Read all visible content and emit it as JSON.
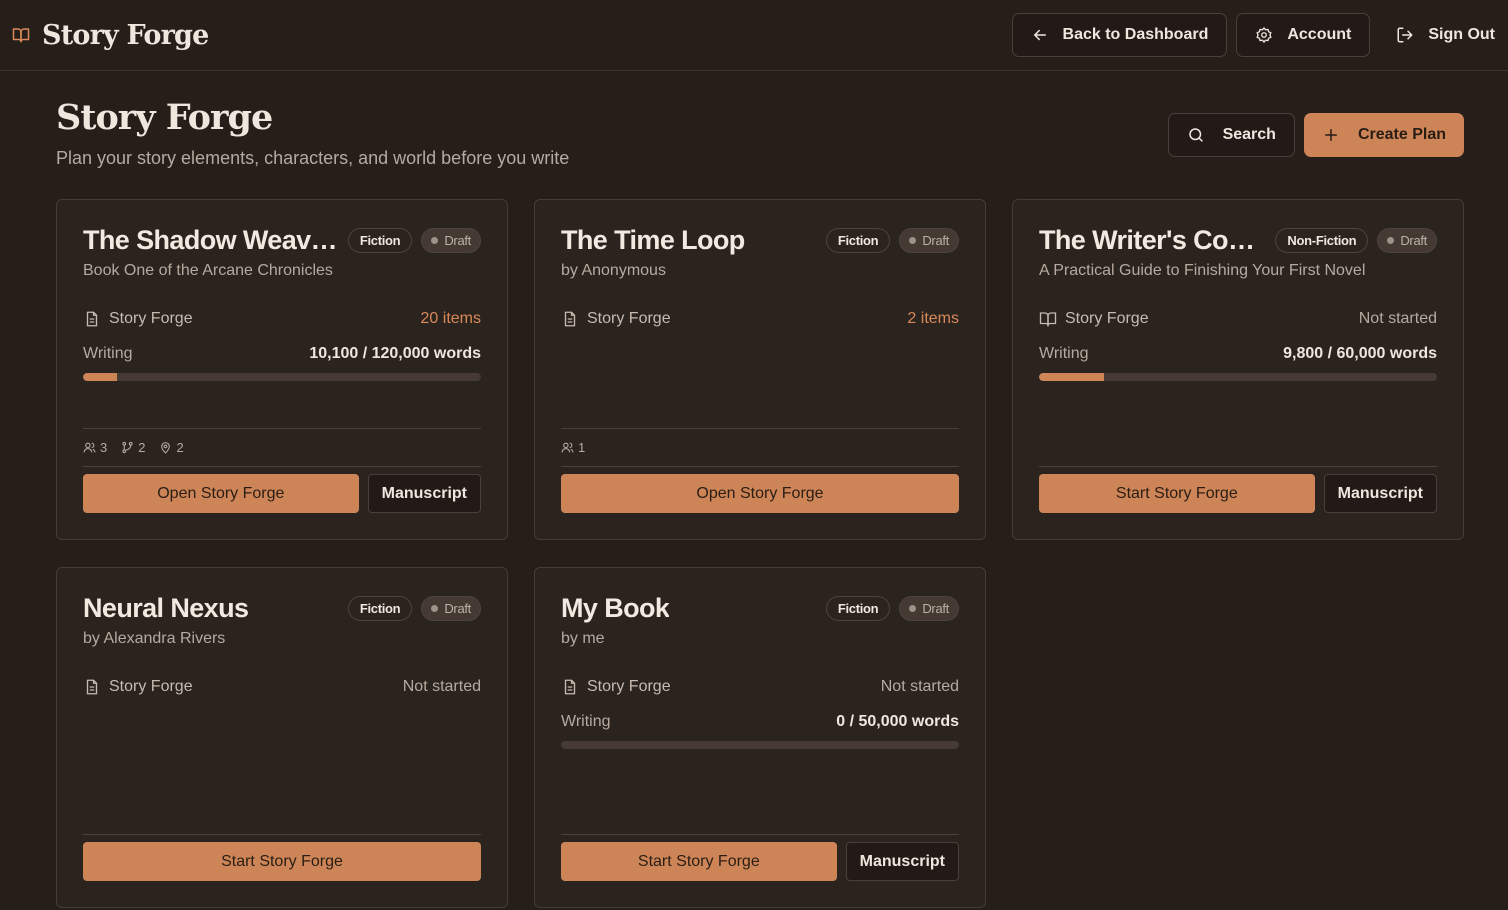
{
  "header": {
    "brand": "Story Forge",
    "back_label": "Back to Dashboard",
    "account_label": "Account",
    "signout_label": "Sign Out"
  },
  "page": {
    "title": "Story Forge",
    "subtitle": "Plan your story elements, characters, and world before you write",
    "search_label": "Search",
    "create_label": "Create Plan"
  },
  "colors": {
    "accent": "#cd8558",
    "background": "#251e19",
    "card": "#2b231d"
  },
  "cards": [
    {
      "title": "The Shadow Weav…",
      "genre": "Fiction",
      "status": "Draft",
      "subtitle": "Book One of the Arcane Chronicles",
      "plan_label": "Story Forge",
      "plan_icon": "document-icon",
      "plan_status": "20 items",
      "writing_label": "Writing",
      "words": "10,100 / 120,000 words",
      "progress": 0.0842,
      "stats": {
        "characters": "3",
        "plotlines": "2",
        "locations": "2"
      },
      "primary_label": "Open Story Forge",
      "secondary_label": "Manuscript"
    },
    {
      "title": "The Time Loop",
      "genre": "Fiction",
      "status": "Draft",
      "subtitle": "by Anonymous",
      "plan_label": "Story Forge",
      "plan_icon": "document-icon",
      "plan_status": "2 items",
      "stats": {
        "characters": "1"
      },
      "primary_label": "Open Story Forge"
    },
    {
      "title": "The Writer's Co…",
      "genre": "Non-Fiction",
      "status": "Draft",
      "subtitle": "A Practical Guide to Finishing Your First Novel",
      "plan_label": "Story Forge",
      "plan_icon": "book-open-icon",
      "plan_status": "Not started",
      "writing_label": "Writing",
      "words": "9,800 / 60,000 words",
      "progress": 0.1633,
      "primary_label": "Start Story Forge",
      "secondary_label": "Manuscript"
    },
    {
      "title": "Neural Nexus",
      "genre": "Fiction",
      "status": "Draft",
      "subtitle": "by Alexandra Rivers",
      "plan_label": "Story Forge",
      "plan_icon": "document-icon",
      "plan_status": "Not started",
      "primary_label": "Start Story Forge"
    },
    {
      "title": "My Book",
      "genre": "Fiction",
      "status": "Draft",
      "subtitle": "by me",
      "plan_label": "Story Forge",
      "plan_icon": "document-icon",
      "plan_status": "Not started",
      "writing_label": "Writing",
      "words": "0 / 50,000 words",
      "progress": 0,
      "primary_label": "Start Story Forge",
      "secondary_label": "Manuscript"
    }
  ]
}
